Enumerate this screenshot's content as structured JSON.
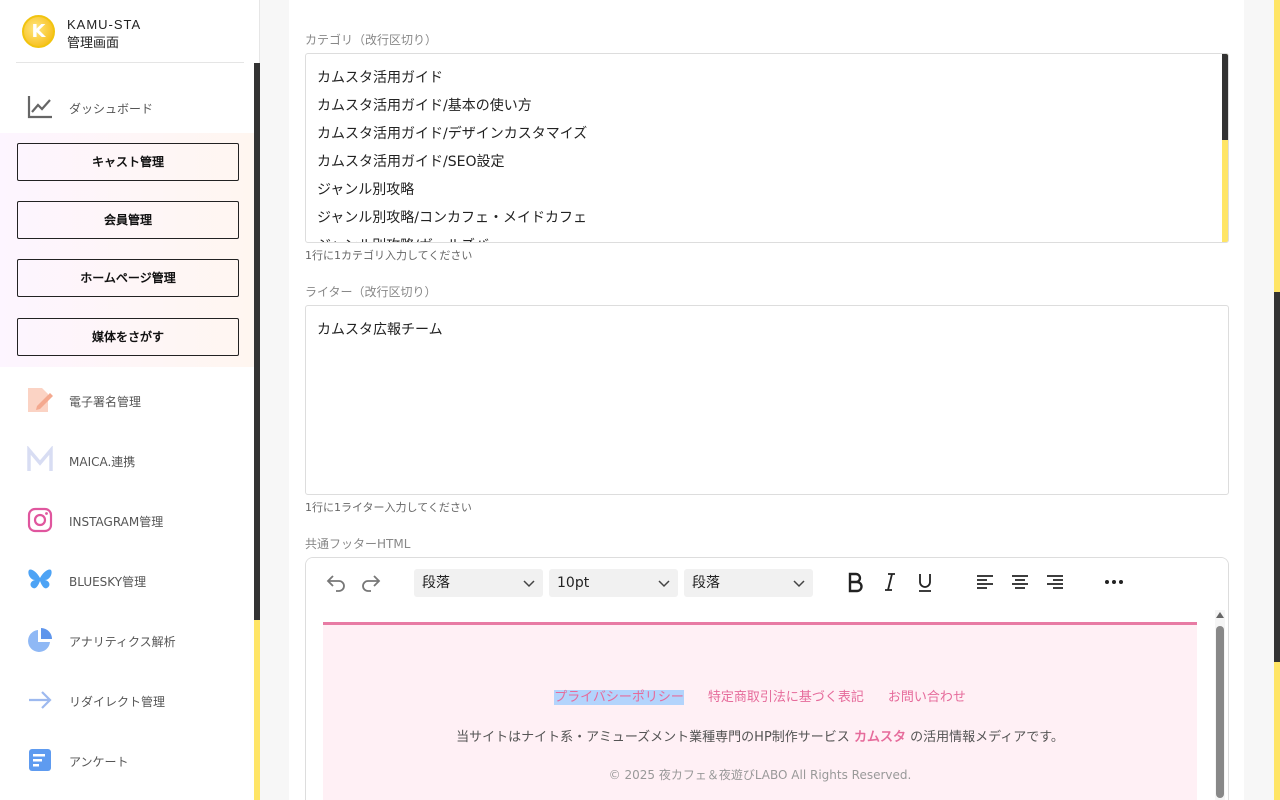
{
  "brand": {
    "name": "KAMU-STA",
    "subtitle": "管理画面",
    "logo_letter": "K"
  },
  "sidebar": {
    "dashboard": "ダッシュボード",
    "group_buttons": [
      "キャスト管理",
      "会員管理",
      "ホームページ管理",
      "媒体をさがす"
    ],
    "items": [
      {
        "label": "電子署名管理",
        "icon": "signature-icon"
      },
      {
        "label": "MAICA.連携",
        "icon": "maica-logo-icon"
      },
      {
        "label": "INSTAGRAM管理",
        "icon": "instagram-icon"
      },
      {
        "label": "BLUESKY管理",
        "icon": "bluesky-icon"
      },
      {
        "label": "アナリティクス解析",
        "icon": "pie-chart-icon"
      },
      {
        "label": "リダイレクト管理",
        "icon": "arrow-right-icon"
      },
      {
        "label": "アンケート",
        "icon": "survey-icon"
      }
    ]
  },
  "category": {
    "label": "カテゴリ（改行区切り）",
    "lines": [
      "カムスタ活用ガイド",
      "カムスタ活用ガイド/基本の使い方",
      "カムスタ活用ガイド/デザインカスタマイズ",
      "カムスタ活用ガイド/SEO設定",
      "ジャンル別攻略",
      "ジャンル別攻略/コンカフェ・メイドカフェ",
      "ジャンル別攻略/ガールズバー"
    ],
    "help": "1行に1カテゴリ入力してください"
  },
  "writer": {
    "label": "ライター（改行区切り）",
    "value": "カムスタ広報チーム",
    "help": "1行に1ライター入力してください"
  },
  "footer_html": {
    "label": "共通フッターHTML",
    "toolbar": {
      "block_format_1": "段落",
      "font_size": "10pt",
      "block_format_2": "段落"
    },
    "links": [
      "プライバシーポリシー",
      "特定商取引法に基づく表記",
      "お問い合わせ"
    ],
    "desc_before": "当サイトはナイト系・アミューズメント業種専門のHP制作サービス",
    "desc_brand": "カムスタ",
    "desc_after": "の活用情報メディアです。",
    "copyright": "© 2025 夜カフェ＆夜遊びLABO All Rights Reserved."
  },
  "colors": {
    "accent_yellow": "#ffe566",
    "pink": "#e87ba4",
    "selection": "#b3d4fc"
  }
}
